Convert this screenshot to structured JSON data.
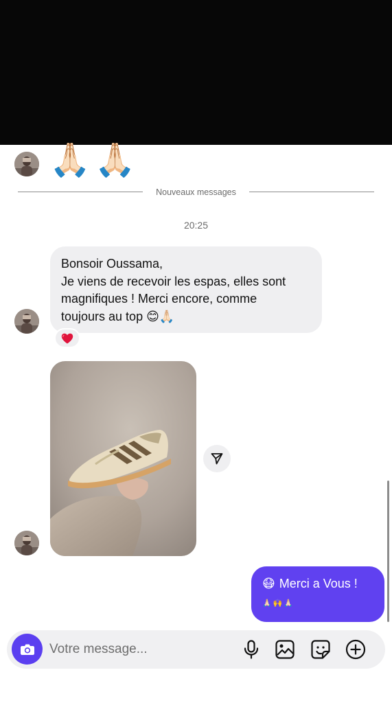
{
  "header": {
    "black_area": "redacted"
  },
  "history": {
    "emoji_message": "🙏🏻🙏🏻"
  },
  "divider": {
    "label": "Nouveaux messages"
  },
  "timestamp": "20:25",
  "incoming_message": {
    "lines": [
      "Bonsoir Oussama,",
      "Je viens de recevoir les espas, elles sont",
      "magnifiques ! Merci encore, comme",
      "toujours au top 😊🙏🏻"
    ],
    "reaction_icon": "red-heart-icon"
  },
  "photo_message": {
    "subject": "sneaker-photo",
    "share_icon": "share-icon"
  },
  "outgoing_message": {
    "text": "Merci a Vous !",
    "leading_emoji": "😷",
    "emoji_line": "🙏🏻🙌🙏🏻"
  },
  "composer": {
    "placeholder": "Votre message...",
    "camera_icon": "camera-icon",
    "mic_icon": "microphone-icon",
    "gallery_icon": "image-icon",
    "sticker_icon": "sticker-icon",
    "plus_icon": "plus-circle-icon"
  },
  "colors": {
    "accent": "#5b3ff0",
    "incoming_bubble": "#efeff1",
    "header": "#070707"
  }
}
